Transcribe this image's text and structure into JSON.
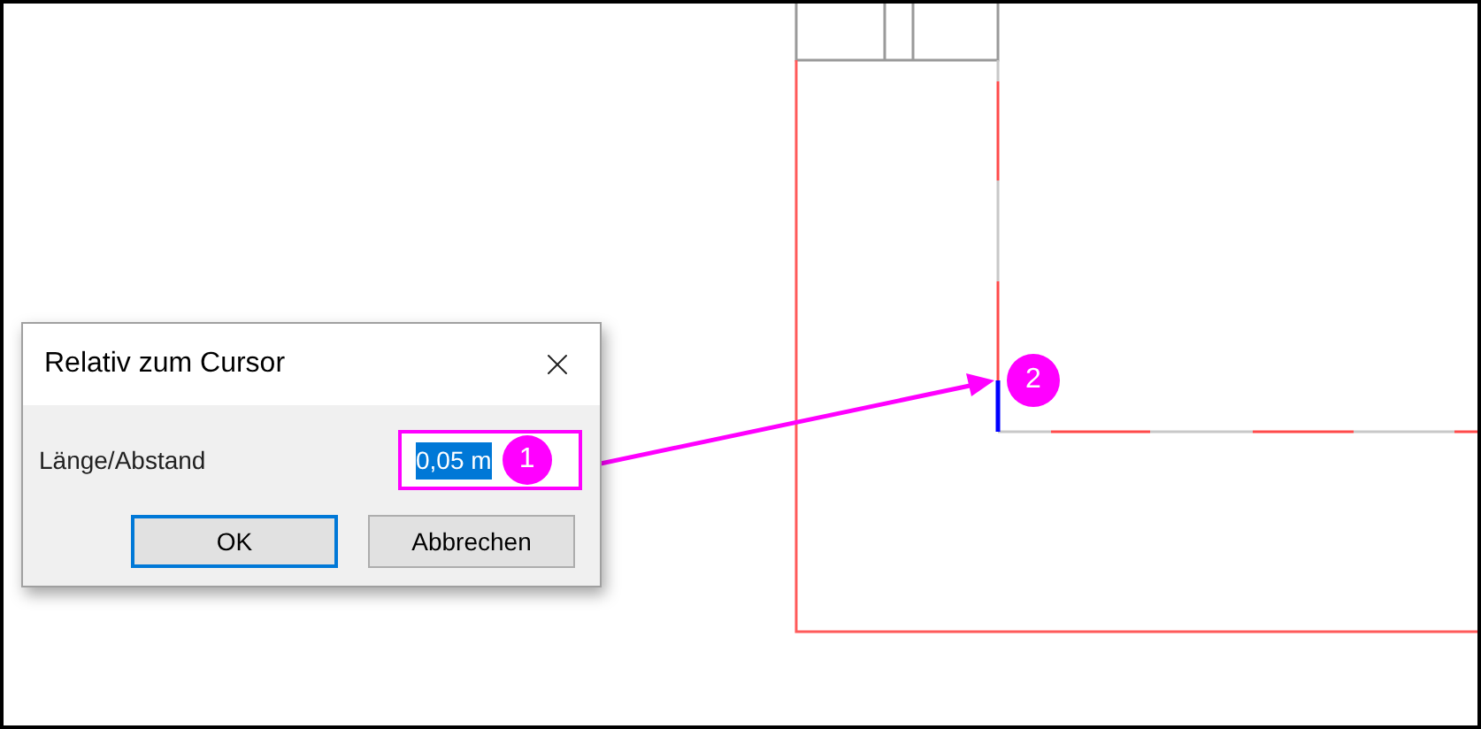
{
  "dialog": {
    "title": "Relativ zum Cursor",
    "field": {
      "label": "Länge/Abstand",
      "value": "0,05 m",
      "selected": true,
      "highlighted": true
    },
    "buttons": [
      {
        "label": "OK",
        "default": true
      },
      {
        "label": "Abbrechen",
        "default": false
      }
    ]
  },
  "callouts": [
    "1",
    "2"
  ]
}
